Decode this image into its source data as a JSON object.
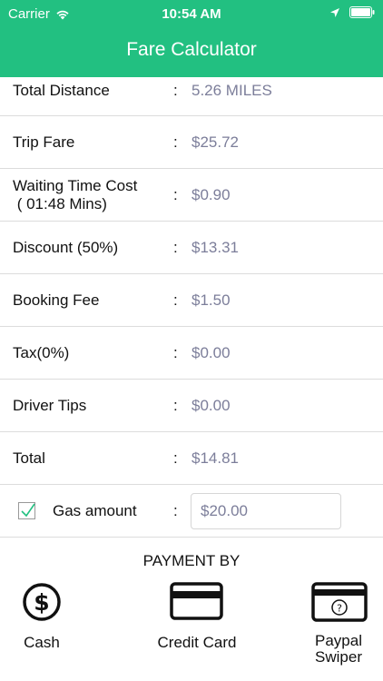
{
  "status_bar": {
    "carrier": "Carrier",
    "time": "10:54 AM"
  },
  "header": {
    "title": "Fare Calculator"
  },
  "rows": {
    "total_distance": {
      "label": "Total Distance",
      "colon": ":",
      "value": "5.26 MILES"
    },
    "trip_fare": {
      "label": "Trip Fare",
      "colon": ":",
      "value": "$25.72"
    },
    "waiting_time": {
      "label_line1": "Waiting Time Cost",
      "label_line2": " ( 01:48 Mins)",
      "colon": ":",
      "value": "$0.90"
    },
    "discount": {
      "label": "Discount (50%)",
      "colon": ":",
      "value": "$13.31"
    },
    "booking_fee": {
      "label": "Booking Fee",
      "colon": ":",
      "value": "$1.50"
    },
    "tax": {
      "label": "Tax(0%)",
      "colon": ":",
      "value": "$0.00"
    },
    "driver_tips": {
      "label": "Driver Tips",
      "colon": ":",
      "value": "$0.00"
    },
    "total": {
      "label": "Total",
      "colon": ":",
      "value": "$14.81"
    },
    "gas_amount": {
      "label": "Gas amount",
      "colon": ":",
      "value": "$20.00",
      "checked": true
    }
  },
  "payment": {
    "title": "PAYMENT BY",
    "options": [
      {
        "label": "Cash",
        "icon": "dollar-icon"
      },
      {
        "label": "Credit Card",
        "icon": "credit-card-icon"
      },
      {
        "label_line1": "Paypal",
        "label_line2": "Swiper",
        "icon": "card-swiper-icon"
      }
    ]
  },
  "colors": {
    "header": "#22c081",
    "value_text": "#7c7e9a",
    "check": "#22c081"
  }
}
